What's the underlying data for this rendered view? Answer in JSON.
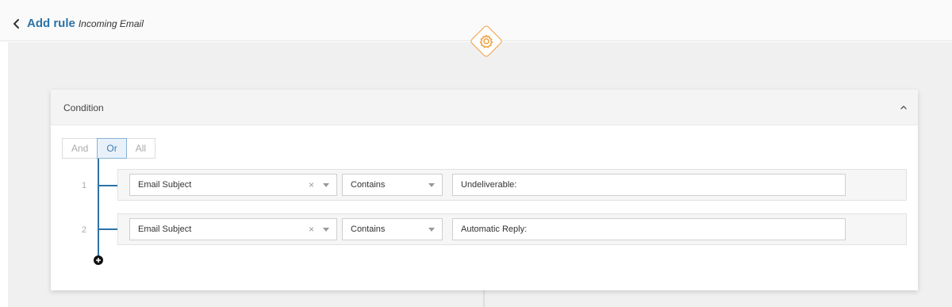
{
  "header": {
    "title": "Add rule",
    "subtitle": "Incoming Email"
  },
  "condition": {
    "title": "Condition",
    "logic_options": [
      "And",
      "Or",
      "All"
    ],
    "selected_logic": "Or",
    "rows": [
      {
        "index": "1",
        "field": "Email Subject",
        "operator": "Contains",
        "value": "Undeliverable:"
      },
      {
        "index": "2",
        "field": "Email Subject",
        "operator": "Contains",
        "value": "Automatic Reply:"
      }
    ]
  },
  "icons": {
    "back": "chevron-left-icon",
    "node": "gear-icon",
    "collapse": "chevron-up-icon",
    "add": "plus-circle-icon",
    "clear": "close-icon",
    "dropdown": "caret-down-icon"
  },
  "colors": {
    "accent": "#2b72a6",
    "node_border": "#f0a040"
  },
  "glyphs": {
    "clear": "×"
  }
}
